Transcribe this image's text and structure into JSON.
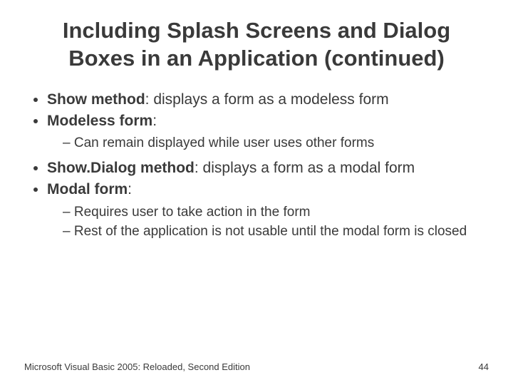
{
  "title": "Including Splash Screens and Dialog Boxes in an Application (continued)",
  "bullets": {
    "b1_bold": "Show method",
    "b1_rest": ": displays a form as a modeless form",
    "b2_bold": "Modeless form",
    "b2_rest": ":",
    "b2_sub1": "Can remain displayed while user uses other forms",
    "b3_bold": "Show.Dialog method",
    "b3_rest": ": displays a form as a modal form",
    "b4_bold": "Modal form",
    "b4_rest": ":",
    "b4_sub1": "Requires user to take action in the form",
    "b4_sub2": "Rest of the application is not usable until the modal form is closed"
  },
  "footer": {
    "left": "Microsoft Visual Basic 2005: Reloaded, Second Edition",
    "right": "44"
  }
}
